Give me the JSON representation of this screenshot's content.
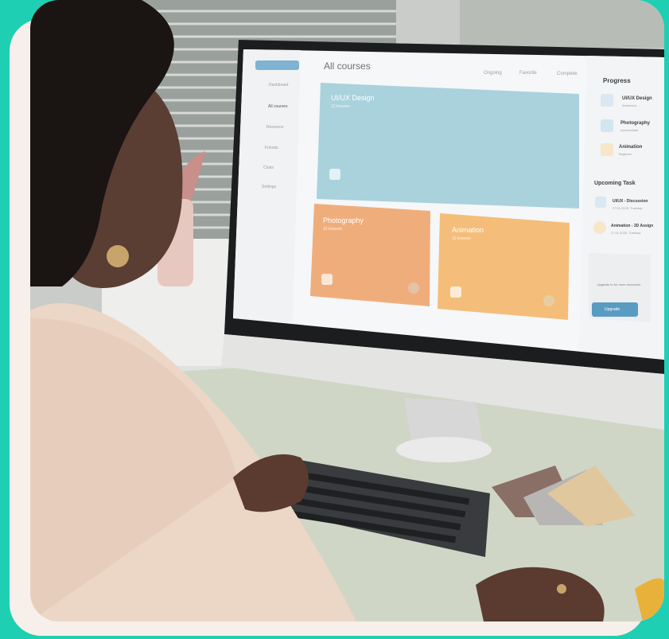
{
  "screen": {
    "page_title": "All courses",
    "tabs": [
      "Ongoing",
      "Favorite",
      "Complete"
    ],
    "sidebar_items": [
      "Dashboard",
      "All courses",
      "Resource",
      "Friends",
      "Chats",
      "Settings"
    ],
    "courses": [
      {
        "title": "UI/UX Design",
        "subtitle": "12 lessons",
        "color": "#a9d2dd"
      },
      {
        "title": "Photography",
        "subtitle": "12 lessons",
        "color": "#f0ad7c"
      },
      {
        "title": "Animation",
        "subtitle": "12 lessons",
        "color": "#f4be7a"
      }
    ],
    "progress": {
      "heading": "Progress",
      "items": [
        {
          "title": "UI/UX Design",
          "sub": "Advanced"
        },
        {
          "title": "Photography",
          "sub": "Intermediate"
        },
        {
          "title": "Animation",
          "sub": "Beginner"
        }
      ]
    },
    "tasks": {
      "heading": "Upcoming Task",
      "items": [
        {
          "title": "UI/UX - Discussion",
          "sub": "27.01.2025, Tuesday"
        },
        {
          "title": "Animation - 3D Assign",
          "sub": "27.01.2025, Tuesday"
        }
      ]
    },
    "upgrade": {
      "text": "Upgrade to for more resources",
      "button": "Upgrade"
    }
  },
  "colors": {
    "frame": "#1fcfb3",
    "card": "#f7f0ea",
    "accent": "#5a9bc2"
  }
}
